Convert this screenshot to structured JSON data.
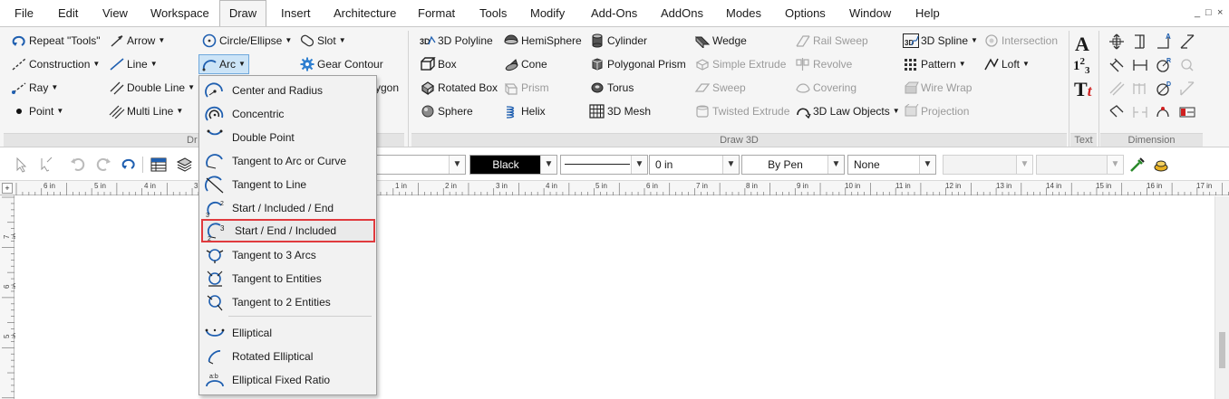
{
  "menubar": {
    "items": [
      "File",
      "Edit",
      "View",
      "Workspace",
      "Draw",
      "Insert",
      "Architecture",
      "Format",
      "Tools",
      "Modify",
      "Add-Ons",
      "AddOns",
      "Modes",
      "Options",
      "Window",
      "Help"
    ],
    "active": "Draw",
    "window_controls": [
      "_",
      "□",
      "×"
    ]
  },
  "ribbon": {
    "draw2d": {
      "col1": [
        {
          "label": "Repeat \"Tools\"",
          "icon": "repeat-icon"
        },
        {
          "label": "Construction",
          "icon": "construction-line-icon",
          "dropdown": true
        },
        {
          "label": "Ray",
          "icon": "ray-icon",
          "dropdown": true
        },
        {
          "label": "Point",
          "icon": "point-icon",
          "dropdown": true
        }
      ],
      "col2": [
        {
          "label": "Arrow",
          "icon": "arrow-icon",
          "dropdown": true
        },
        {
          "label": "Line",
          "icon": "line-icon",
          "dropdown": true
        },
        {
          "label": "Double Line",
          "icon": "double-line-icon",
          "dropdown": true
        },
        {
          "label": "Multi Line",
          "icon": "multi-line-icon",
          "dropdown": true
        }
      ],
      "col3": [
        {
          "label": "Circle/Ellipse",
          "icon": "circle-icon",
          "dropdown": true
        },
        {
          "label": "Arc",
          "icon": "arc-icon",
          "dropdown": true
        }
      ],
      "col4": [
        {
          "label": "Slot",
          "icon": "slot-icon",
          "dropdown": true
        },
        {
          "label": "Gear Contour",
          "icon": "gear-icon"
        },
        {
          "label": "ygon",
          "icon": ""
        }
      ],
      "group_label_fragment": "Dr"
    },
    "draw3d": {
      "col1": [
        {
          "label": "3D Polyline",
          "icon": "3d-polyline-icon"
        },
        {
          "label": "Box",
          "icon": "box-icon"
        },
        {
          "label": "Rotated Box",
          "icon": "rotated-box-icon"
        },
        {
          "label": "Sphere",
          "icon": "sphere-icon"
        }
      ],
      "col2": [
        {
          "label": "HemiSphere",
          "icon": "hemisphere-icon"
        },
        {
          "label": "Cone",
          "icon": "cone-icon"
        },
        {
          "label": "Prism",
          "icon": "prism-icon",
          "disabled": true
        },
        {
          "label": "Helix",
          "icon": "helix-icon"
        }
      ],
      "col3": [
        {
          "label": "Cylinder",
          "icon": "cylinder-icon"
        },
        {
          "label": "Polygonal Prism",
          "icon": "polygonal-prism-icon"
        },
        {
          "label": "Torus",
          "icon": "torus-icon"
        },
        {
          "label": "3D Mesh",
          "icon": "mesh-icon"
        }
      ],
      "col4": [
        {
          "label": "Wedge",
          "icon": "wedge-icon"
        },
        {
          "label": "Simple Extrude",
          "icon": "simple-extrude-icon",
          "disabled": true
        },
        {
          "label": "Sweep",
          "icon": "sweep-icon",
          "disabled": true
        },
        {
          "label": "Twisted Extrude",
          "icon": "twisted-extrude-icon",
          "disabled": true
        }
      ],
      "col5": [
        {
          "label": "Rail Sweep",
          "icon": "rail-sweep-icon",
          "disabled": true
        },
        {
          "label": "Revolve",
          "icon": "revolve-icon",
          "disabled": true
        },
        {
          "label": "Covering",
          "icon": "covering-icon",
          "disabled": true
        },
        {
          "label": "3D Law Objects",
          "icon": "law-objects-icon",
          "dropdown": true
        }
      ],
      "col6": [
        {
          "label": "3D Spline",
          "icon": "3d-spline-icon",
          "dropdown": true
        },
        {
          "label": "Pattern",
          "icon": "pattern-icon",
          "dropdown": true
        },
        {
          "label": "Wire Wrap",
          "icon": "wire-wrap-icon",
          "disabled": true
        },
        {
          "label": "Projection",
          "icon": "projection-icon",
          "disabled": true
        }
      ],
      "col7": [
        {
          "label": "Intersection",
          "icon": "intersection-icon",
          "disabled": true
        },
        {
          "label": "Loft",
          "icon": "loft-icon",
          "dropdown": true
        }
      ],
      "group_label": "Draw 3D"
    },
    "text": {
      "group_label": "Text",
      "glyphs": [
        "A",
        "1",
        "2",
        "3",
        "T",
        "t"
      ]
    },
    "dimension": {
      "group_label": "Dimension"
    }
  },
  "property_toolbar": {
    "color_value": "Black",
    "color_swatch": "#000000",
    "line_width": "0 in",
    "pen_value": "By Pen",
    "fill_value": "None"
  },
  "rulers": {
    "h_labels": [
      "6 in",
      "5 in",
      "4 in",
      "3",
      "1 in",
      "2 in",
      "3 in",
      "4 in",
      "5 in",
      "6 in",
      "7 in",
      "8 in",
      "9 in",
      "10 in",
      "11 in",
      "12 in",
      "13 in",
      "14 in",
      "15 in",
      "16 in",
      "17 in"
    ],
    "v_labels": [
      "7 in",
      "6 in",
      "5 in"
    ]
  },
  "arc_dropdown": {
    "items": [
      {
        "label": "Center and Radius",
        "icon": "center-radius-arc-icon"
      },
      {
        "label": "Concentric",
        "icon": "concentric-arc-icon"
      },
      {
        "label": "Double Point",
        "icon": "double-point-arc-icon"
      },
      {
        "label": "Tangent to Arc or Curve",
        "icon": "tangent-arc-icon"
      },
      {
        "label": "Tangent to Line",
        "icon": "tangent-line-arc-icon"
      },
      {
        "label": "Start / Included / End",
        "icon": "start-included-end-icon"
      },
      {
        "label": "Start / End / Included",
        "icon": "start-end-included-icon",
        "highlighted": true
      },
      {
        "label": "Tangent to 3 Arcs",
        "icon": "tangent-3-arcs-icon"
      },
      {
        "label": "Tangent to Entities",
        "icon": "tangent-entities-icon"
      },
      {
        "label": "Tangent to 2 Entities",
        "icon": "tangent-2-entities-icon"
      },
      {
        "label": "Elliptical",
        "icon": "elliptical-arc-icon"
      },
      {
        "label": "Rotated Elliptical",
        "icon": "rotated-elliptical-arc-icon"
      },
      {
        "label": "Elliptical Fixed Ratio",
        "icon": "elliptical-fixed-ratio-icon"
      }
    ],
    "highlight_color": "#e03a3e"
  }
}
